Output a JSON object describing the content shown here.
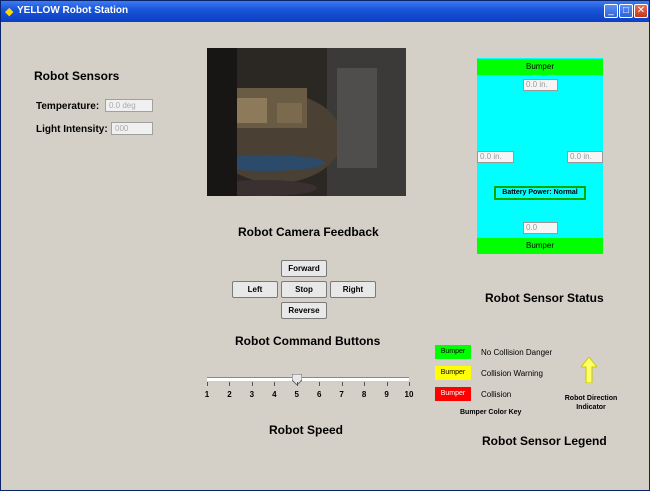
{
  "window": {
    "title": "YELLOW Robot Station",
    "minimize": "_",
    "maximize": "□",
    "close": "✕"
  },
  "sensors": {
    "heading": "Robot Sensors",
    "temperature_label": "Temperature:",
    "temperature_value": "0.0 deg",
    "light_label": "Light Intensity:",
    "light_value": "000"
  },
  "camera": {
    "heading": "Robot Camera Feedback"
  },
  "commands": {
    "heading": "Robot Command Buttons",
    "forward": "Forward",
    "left": "Left",
    "stop": "Stop",
    "right": "Right",
    "reverse": "Reverse"
  },
  "speed": {
    "heading": "Robot Speed",
    "value": 5,
    "min": 1,
    "max": 10,
    "ticks": [
      "1",
      "2",
      "3",
      "4",
      "5",
      "6",
      "7",
      "8",
      "9",
      "10"
    ]
  },
  "status": {
    "heading": "Robot Sensor Status",
    "top_bumper": "Bumper",
    "bottom_bumper": "Bumper",
    "front_distance": "0.0 in.",
    "left_distance": "0.0 in.",
    "right_distance": "0.0 in.",
    "rear_distance": "0.0",
    "battery": "Battery Power: Normal"
  },
  "legend": {
    "heading": "Robot Sensor Legend",
    "items": [
      {
        "chip": "Bumper",
        "text": "No Collision Danger",
        "color": "#00ff00",
        "text_color": "#000000"
      },
      {
        "chip": "Bumper",
        "text": "Collision Warning",
        "color": "#ffff00",
        "text_color": "#000000"
      },
      {
        "chip": "Bumper",
        "text": "Collision",
        "color": "#ff0000",
        "text_color": "#ffffff"
      }
    ],
    "key_label": "Bumper Color Key",
    "direction_label_1": "Robot Direction",
    "direction_label_2": "Indicator",
    "arrow_color": "#ffff66"
  }
}
